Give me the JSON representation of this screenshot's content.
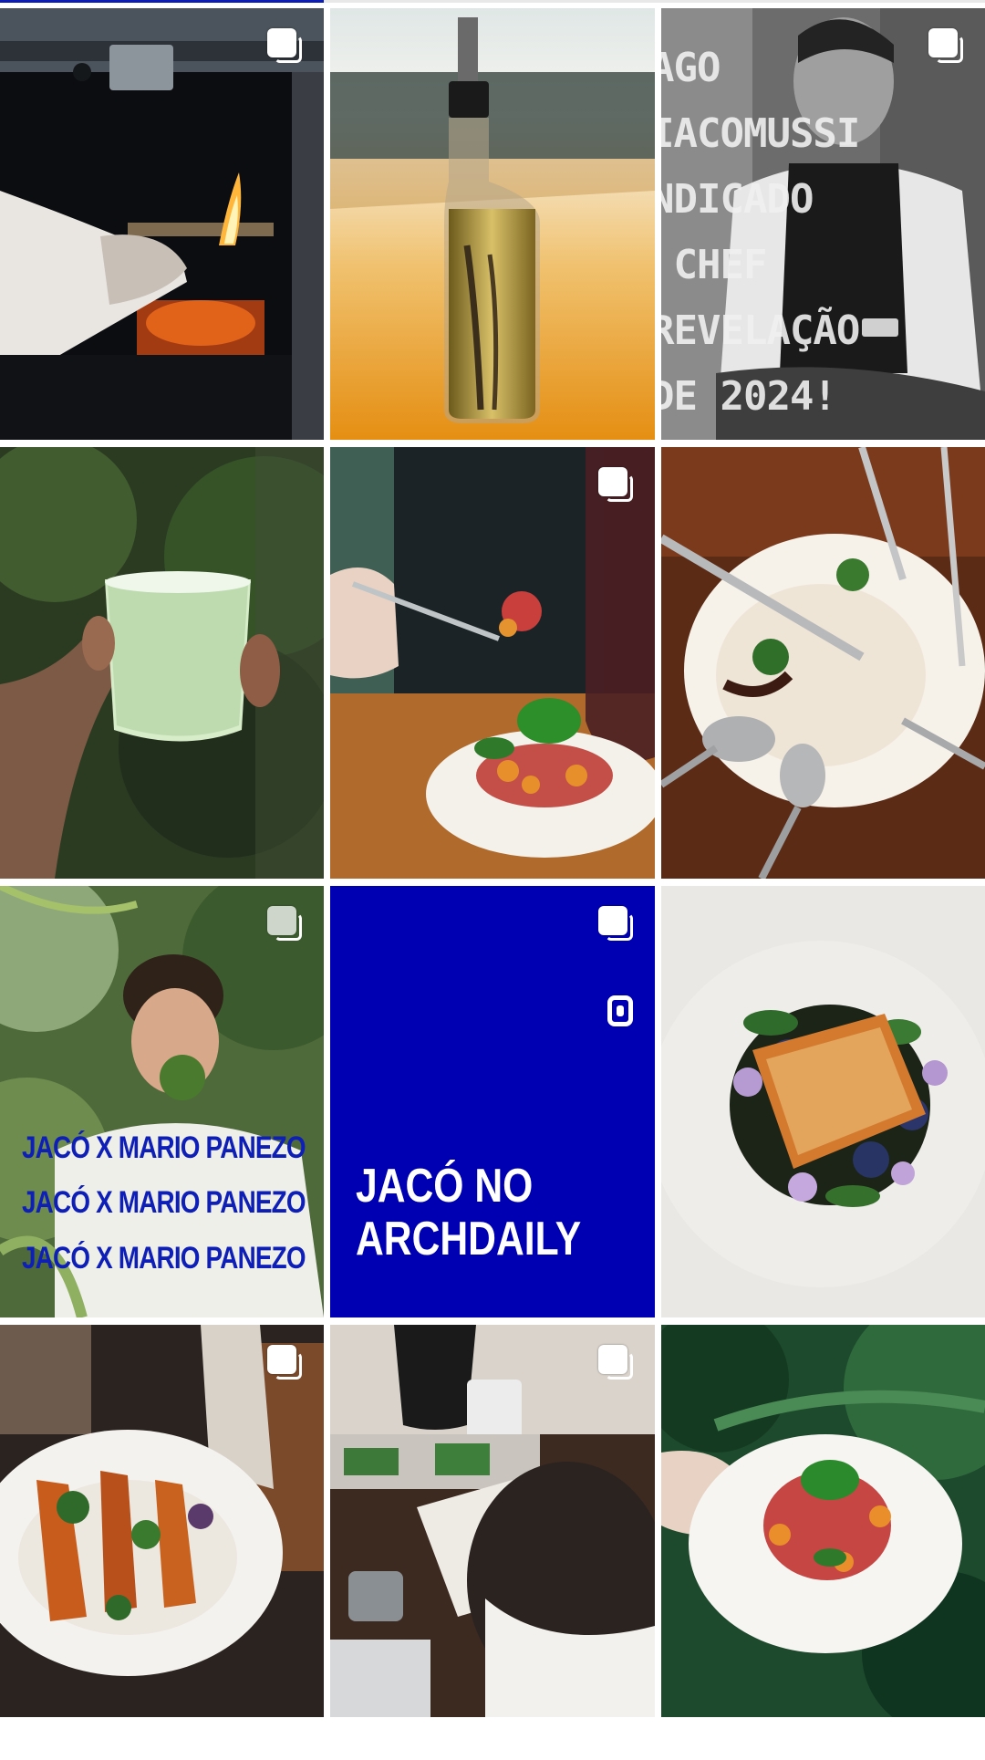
{
  "grid": {
    "tiles": [
      {
        "id": "grill",
        "carousel": true,
        "colors": [
          "#0b0c10",
          "#3a3f46",
          "#d5531a"
        ]
      },
      {
        "id": "oil-bottle",
        "carousel": false,
        "colors": [
          "#e8a42c",
          "#f6f1e4",
          "#1f2a23"
        ]
      },
      {
        "id": "chef-revelation",
        "carousel": true,
        "overlay_lines": [
          "AGO",
          "IACOMUSSI",
          "NDICADO",
          " CHEF",
          "REVELAÇÃO",
          "DE 2024!"
        ]
      },
      {
        "id": "cocktail",
        "carousel": false,
        "colors": [
          "#2f4c24",
          "#cbe8c2"
        ]
      },
      {
        "id": "tartare-fork",
        "carousel": true,
        "colors": [
          "#2a1d18",
          "#f1eee6",
          "#c84a3f"
        ]
      },
      {
        "id": "empty-plate",
        "carousel": false,
        "colors": [
          "#5a2a15",
          "#f4efe6"
        ]
      },
      {
        "id": "mario-panezo",
        "carousel": true,
        "overlay_lines": [
          "JACÓ X MARIO PANEZO",
          "JACÓ X MARIO PANEZO",
          "JACÓ X MARIO PANEZO"
        ]
      },
      {
        "id": "archdaily",
        "carousel": true,
        "title": "JACÓ NO\nARCHDAILY",
        "bg": "#0000b3"
      },
      {
        "id": "fish-plate",
        "carousel": false,
        "colors": [
          "#ecebe7",
          "#d67e2f",
          "#2b6b2a"
        ]
      },
      {
        "id": "pumpkin-plate",
        "carousel": true,
        "colors": [
          "#2b221d",
          "#f4f2ee",
          "#c4581f"
        ]
      },
      {
        "id": "kitchen-notes",
        "carousel": true,
        "colors": [
          "#3a2a20",
          "#f3efe8"
        ]
      },
      {
        "id": "tartare-hand",
        "carousel": false,
        "colors": [
          "#0d3a24",
          "#f4f3ef",
          "#c04039"
        ]
      }
    ]
  }
}
